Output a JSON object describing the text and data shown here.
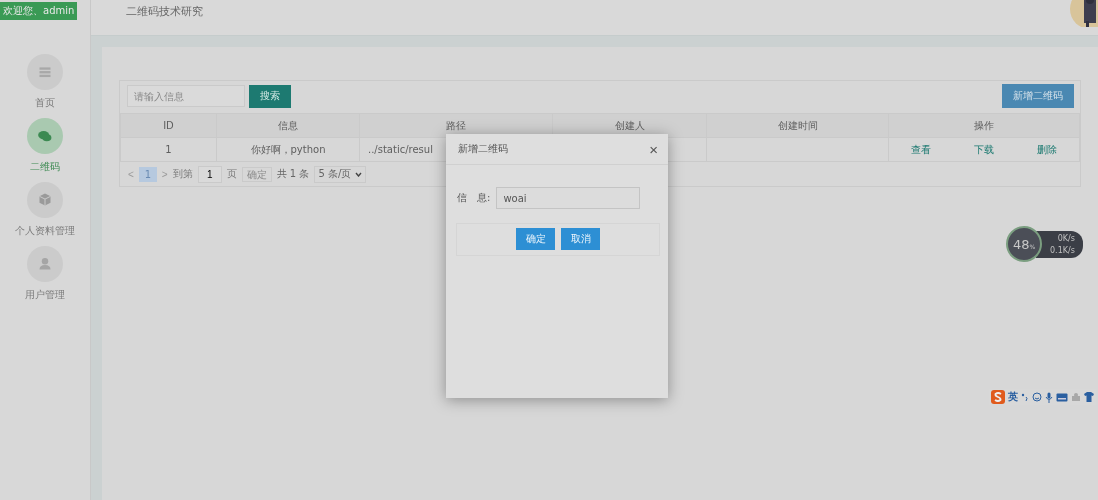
{
  "sidebar": {
    "welcome": "欢迎您、admin",
    "items": [
      {
        "label": "首页",
        "selected": false
      },
      {
        "label": "二维码",
        "selected": true
      },
      {
        "label": "个人资料管理",
        "selected": false
      },
      {
        "label": "用户管理",
        "selected": false
      }
    ]
  },
  "header": {
    "title": "二维码技术研究"
  },
  "toolbar": {
    "search": {
      "placeholder": "请输入信息"
    },
    "search_button": "搜索",
    "add_button": "新增二维码"
  },
  "table": {
    "columns": [
      "ID",
      "信息",
      "路径",
      "创建人",
      "创建时间",
      "操作"
    ],
    "rows": [
      {
        "cells": [
          "1",
          "你好啊，python",
          "../static/resul"
        ],
        "actions": [
          "查看",
          "下载",
          "删除"
        ]
      }
    ]
  },
  "pager": {
    "prev": "<",
    "page": "1",
    "next": ">",
    "goto": "到第",
    "goto_value": "1",
    "page_unit": "页",
    "confirm": "确定",
    "total": "共 1 条",
    "size": "5 条/页"
  },
  "dialog": {
    "title": "新增二维码",
    "close": "×",
    "field_label": "信　息:",
    "field_value": "woai",
    "buttons": [
      "确定",
      "取消"
    ]
  },
  "net_widget": {
    "percent": "48",
    "unit": "%",
    "up": "0K/s",
    "down": "0.1K/s"
  },
  "ime_bar": {
    "lang": "英"
  }
}
